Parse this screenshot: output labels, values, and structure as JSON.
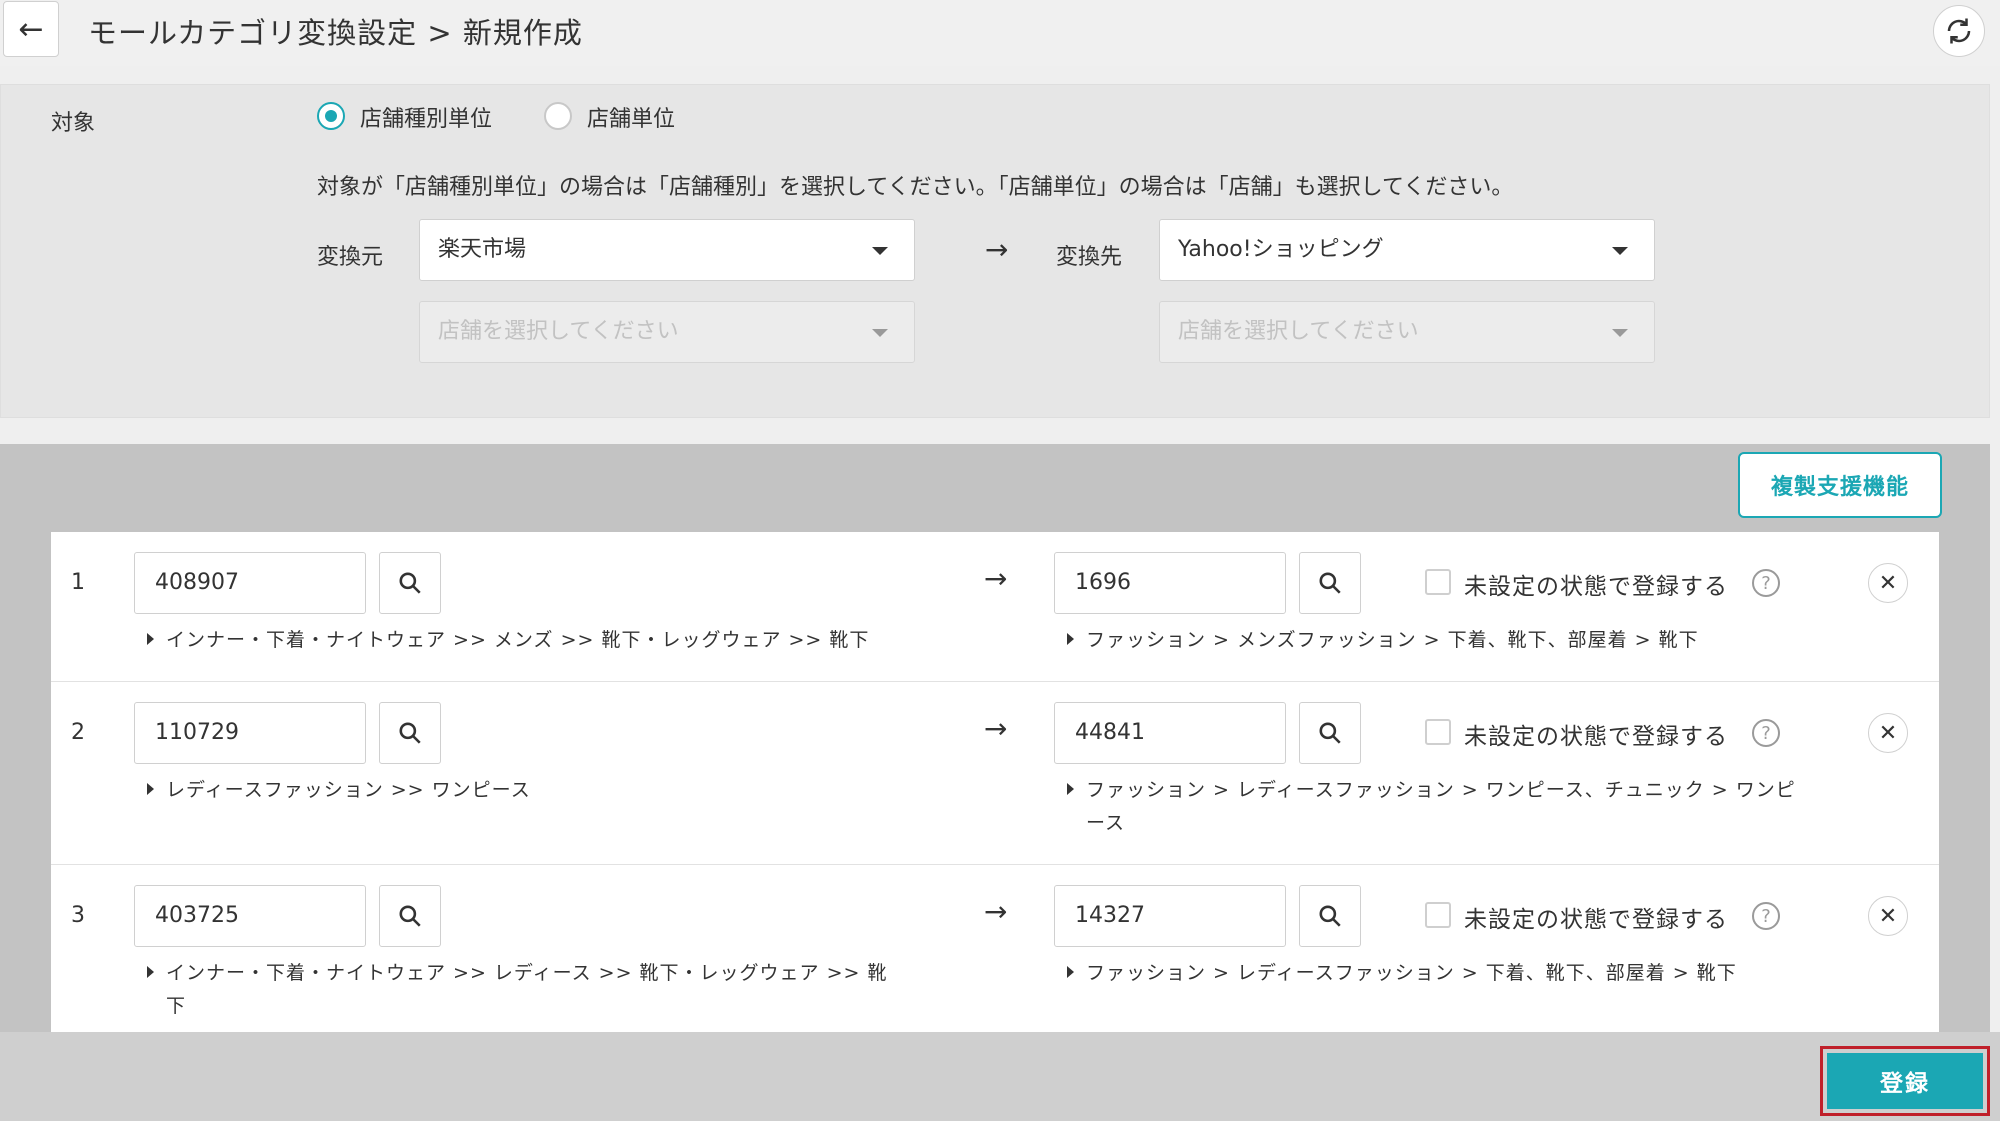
{
  "header": {
    "title": "モールカテゴリ変換設定 > 新規作成"
  },
  "target": {
    "label": "対象",
    "options": [
      {
        "label": "店舗種別単位",
        "selected": true
      },
      {
        "label": "店舗単位",
        "selected": false
      }
    ],
    "instruction": "対象が「店舗種別単位」の場合は「店舗種別」を選択してください。「店舗単位」の場合は「店舗」も選択してください。"
  },
  "source": {
    "label": "変換元",
    "mall": "楽天市場",
    "shop_placeholder": "店舗を選択してください"
  },
  "destination": {
    "label": "変換先",
    "mall": "Yahoo!ショッピング",
    "shop_placeholder": "店舗を選択してください"
  },
  "arrow": "→",
  "duplicate_button": "複製支援機能",
  "checkbox_label": "未設定の状態で登録する",
  "rows": [
    {
      "num": "1",
      "src_id": "408907",
      "src_path": "インナー・下着・ナイトウェア >> メンズ >> 靴下・レッグウェア >> 靴下",
      "dst_id": "1696",
      "dst_path": "ファッション > メンズファッション > 下着、靴下、部屋着 > 靴下"
    },
    {
      "num": "2",
      "src_id": "110729",
      "src_path": "レディースファッション >> ワンピース",
      "dst_id": "44841",
      "dst_path": "ファッション > レディースファッション > ワンピース、チュニック > ワンピ",
      "dst_path2": "ース"
    },
    {
      "num": "3",
      "src_id": "403725",
      "src_path": "インナー・下着・ナイトウェア >> レディース >> 靴下・レッグウェア >> 靴",
      "src_path2": "下",
      "dst_id": "14327",
      "dst_path": "ファッション > レディースファッション > 下着、靴下、部屋着 > 靴下"
    }
  ],
  "register_button": "登録",
  "accent_color": "#1ba7b4",
  "highlight_color": "#c0202a"
}
